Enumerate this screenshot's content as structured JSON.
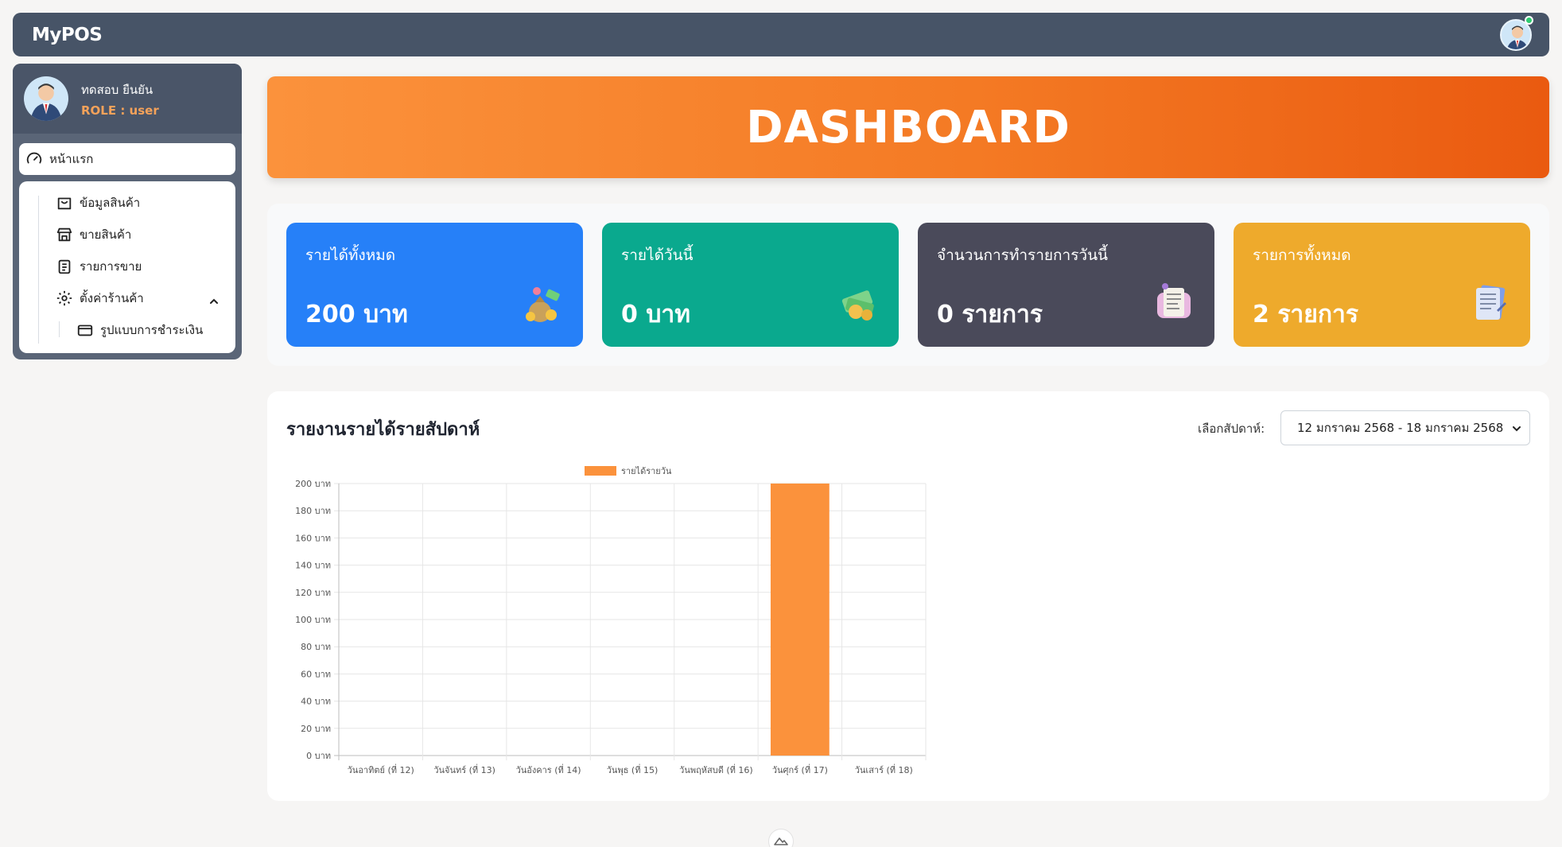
{
  "app": {
    "brand": "MyPOS"
  },
  "user": {
    "name": "ทดสอบ ยืนยัน",
    "role": "ROLE : user"
  },
  "sidebar": {
    "home": "หน้าแรก",
    "items": [
      {
        "label": "ข้อมูลสินค้า",
        "icon": "shopping-bag-icon"
      },
      {
        "label": "ขายสินค้า",
        "icon": "store-icon"
      },
      {
        "label": "รายการขาย",
        "icon": "clipboard-list-icon"
      },
      {
        "label": "ตั้งค่าร้านค้า",
        "icon": "gear-icon",
        "expanded": true
      }
    ],
    "sub_items": [
      {
        "label": "รูปแบบการชำระเงิน",
        "icon": "credit-card-icon"
      }
    ]
  },
  "banner": {
    "title": "DASHBOARD"
  },
  "stats": [
    {
      "label": "รายได้ทั้งหมด",
      "value": "200 บาท",
      "color": "#2680f8",
      "icon": "money-bag-icon"
    },
    {
      "label": "รายได้วันนี้",
      "value": "0 บาท",
      "color": "#0aa98e",
      "icon": "coins-icon"
    },
    {
      "label": "จำนวนการทำรายการวันนี้",
      "value": "0 รายการ",
      "color": "#4a4a5a",
      "icon": "receipt-icon"
    },
    {
      "label": "รายการทั้งหมด",
      "value": "2 รายการ",
      "color": "#eeaa2c",
      "icon": "document-icon"
    }
  ],
  "report": {
    "title": "รายงานรายได้รายสัปดาห์",
    "week_label": "เลือกสัปดาห์:",
    "week_selected": "12 มกราคม 2568 - 18 มกราคม 2568"
  },
  "chart_data": {
    "type": "bar",
    "categories": [
      "วันอาทิตย์ (ที่ 12)",
      "วันจันทร์ (ที่ 13)",
      "วันอังคาร (ที่ 14)",
      "วันพุธ (ที่ 15)",
      "วันพฤหัสบดี (ที่ 16)",
      "วันศุกร์ (ที่ 17)",
      "วันเสาร์ (ที่ 18)"
    ],
    "series": [
      {
        "name": "รายได้รายวัน",
        "values": [
          0,
          0,
          0,
          0,
          0,
          200,
          0
        ],
        "color": "#fb923c"
      }
    ],
    "y_ticks": [
      "0 บาท",
      "20 บาท",
      "40 บาท",
      "60 บาท",
      "80 บาท",
      "100 บาท",
      "120 บาท",
      "140 บาท",
      "160 บาท",
      "180 บาท",
      "200 บาท"
    ],
    "ylim": [
      0,
      200
    ],
    "grid": true,
    "legend": "top-center"
  }
}
